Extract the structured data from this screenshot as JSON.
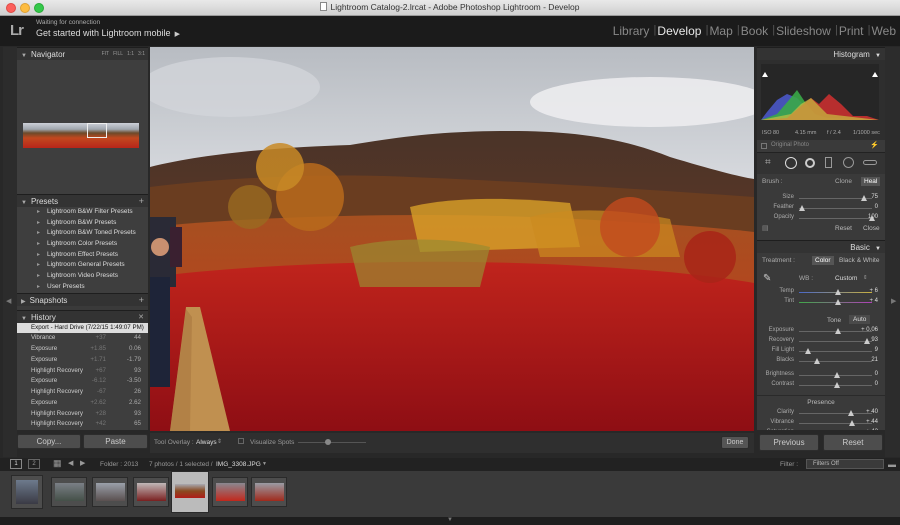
{
  "window": {
    "title": "Lightroom Catalog-2.lrcat - Adobe Photoshop Lightroom - Develop"
  },
  "identity": {
    "logo": "Lr",
    "line1": "Waiting for connection",
    "line2": "Get started with Lightroom mobile"
  },
  "modules": [
    "Library",
    "Develop",
    "Map",
    "Book",
    "Slideshow",
    "Print",
    "Web"
  ],
  "active_module": "Develop",
  "navigator": {
    "title": "Navigator",
    "modes": [
      "FIT",
      "FILL",
      "1:1",
      "3:1"
    ]
  },
  "presets": {
    "title": "Presets",
    "items": [
      "Lightroom B&W Filter Presets",
      "Lightroom B&W Presets",
      "Lightroom B&W Toned Presets",
      "Lightroom Color Presets",
      "Lightroom Effect Presets",
      "Lightroom General Presets",
      "Lightroom Video Presets",
      "User Presets"
    ]
  },
  "snapshots": {
    "title": "Snapshots"
  },
  "history": {
    "title": "History",
    "items": [
      {
        "name": "Export - Hard Drive (7/22/15 1:49:07 PM)",
        "change": "",
        "value": ""
      },
      {
        "name": "Vibrance",
        "change": "+37",
        "value": "44"
      },
      {
        "name": "Exposure",
        "change": "+1.85",
        "value": "0.06"
      },
      {
        "name": "Exposure",
        "change": "+1.71",
        "value": "-1.79"
      },
      {
        "name": "Highlight Recovery",
        "change": "+67",
        "value": "93"
      },
      {
        "name": "Exposure",
        "change": "-6.12",
        "value": "-3.50"
      },
      {
        "name": "Highlight Recovery",
        "change": "-67",
        "value": "26"
      },
      {
        "name": "Exposure",
        "change": "+2.62",
        "value": "2.62"
      },
      {
        "name": "Highlight Recovery",
        "change": "+28",
        "value": "93"
      },
      {
        "name": "Highlight Recovery",
        "change": "+42",
        "value": "65"
      }
    ]
  },
  "left_buttons": {
    "copy": "Copy...",
    "paste": "Paste"
  },
  "toolbar": {
    "overlay_label": "Tool Overlay :",
    "overlay_value": "Always",
    "visualize": "Visualize Spots",
    "done": "Done"
  },
  "histogram": {
    "title": "Histogram",
    "iso": "ISO 80",
    "focal": "4.15 mm",
    "aperture": "f / 2.4",
    "shutter": "1/1000 sec",
    "original": "Original Photo"
  },
  "brush": {
    "label": "Brush :",
    "clone": "Clone",
    "heal": "Heal",
    "sliders": [
      {
        "name": "Size",
        "value": "75",
        "pos": 0.88
      },
      {
        "name": "Feather",
        "value": "0",
        "pos": 0.0
      },
      {
        "name": "Opacity",
        "value": "100",
        "pos": 1.0
      }
    ],
    "reset": "Reset",
    "close": "Close"
  },
  "basic": {
    "title": "Basic",
    "treatment_label": "Treatment :",
    "color": "Color",
    "bw": "Black & White",
    "wb_label": "WB :",
    "wb_value": "Custom",
    "temp": {
      "name": "Temp",
      "value": "+ 6",
      "pos": 0.52
    },
    "tint": {
      "name": "Tint",
      "value": "+ 4",
      "pos": 0.52
    },
    "tone_label": "Tone",
    "auto": "Auto",
    "tone": [
      {
        "name": "Exposure",
        "value": "+ 0.06",
        "pos": 0.52
      },
      {
        "name": "Recovery",
        "value": "93",
        "pos": 0.93
      },
      {
        "name": "Fill Light",
        "value": "9",
        "pos": 0.09
      },
      {
        "name": "Blacks",
        "value": "21",
        "pos": 0.21
      }
    ],
    "tone2": [
      {
        "name": "Brightness",
        "value": "0",
        "pos": 0.5
      },
      {
        "name": "Contrast",
        "value": "0",
        "pos": 0.5
      }
    ],
    "presence_label": "Presence",
    "presence": [
      {
        "name": "Clarity",
        "value": "+ 40",
        "pos": 0.7
      },
      {
        "name": "Vibrance",
        "value": "+ 44",
        "pos": 0.72
      },
      {
        "name": "Saturation",
        "value": "+ 42",
        "pos": 0.71
      }
    ]
  },
  "right_buttons": {
    "previous": "Previous",
    "reset": "Reset"
  },
  "filmstrip_bar": {
    "page1": "1",
    "page2": "2",
    "folder": "Folder : 2013",
    "info": "7 photos / 1 selected /",
    "filename": "IMG_3308.JPG",
    "filter_label": "Filter :",
    "filter_value": "Filters Off"
  },
  "colors": {
    "accent_selected": "#dddddd",
    "panel": "#3a3a3a",
    "background": "#282828"
  }
}
